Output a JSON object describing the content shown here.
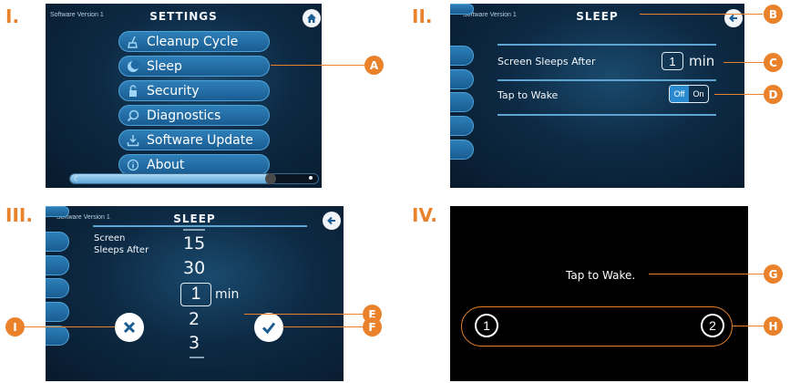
{
  "panels": {
    "p1": {
      "roman": "I.",
      "version": "Software Version 1",
      "title": "SETTINGS",
      "menu": [
        "Cleanup Cycle",
        "Sleep",
        "Security",
        "Diagnostics",
        "Software Update",
        "About"
      ]
    },
    "p2": {
      "roman": "II.",
      "version": "Software Version 1",
      "title": "SLEEP",
      "sleeps_label": "Screen Sleeps After",
      "sleeps_value": "1",
      "sleeps_unit": "min",
      "wake_label": "Tap to Wake",
      "toggle_off": "Off",
      "toggle_on": "On"
    },
    "p3": {
      "roman": "III.",
      "version": "Software Version 1",
      "title": "SLEEP",
      "label_line1": "Screen",
      "label_line2": "Sleeps After",
      "picker": [
        "15",
        "30",
        "1",
        "2",
        "3"
      ],
      "picker_unit": "min"
    },
    "p4": {
      "roman": "IV.",
      "text": "Tap to Wake.",
      "n1": "1",
      "n2": "2"
    }
  },
  "callouts": [
    "A",
    "B",
    "C",
    "D",
    "E",
    "F",
    "G",
    "H",
    "I"
  ],
  "colors": {
    "accent": "#e9822a",
    "button": "#1f6aa3",
    "screen_bg": "#0d2a44"
  }
}
